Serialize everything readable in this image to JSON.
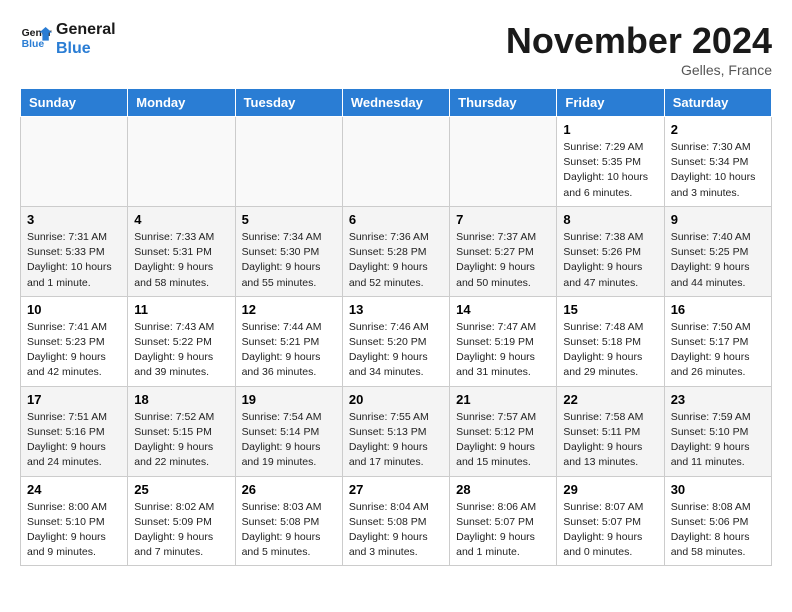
{
  "header": {
    "logo_line1": "General",
    "logo_line2": "Blue",
    "month": "November 2024",
    "location": "Gelles, France"
  },
  "weekdays": [
    "Sunday",
    "Monday",
    "Tuesday",
    "Wednesday",
    "Thursday",
    "Friday",
    "Saturday"
  ],
  "weeks": [
    [
      {
        "day": "",
        "info": ""
      },
      {
        "day": "",
        "info": ""
      },
      {
        "day": "",
        "info": ""
      },
      {
        "day": "",
        "info": ""
      },
      {
        "day": "",
        "info": ""
      },
      {
        "day": "1",
        "info": "Sunrise: 7:29 AM\nSunset: 5:35 PM\nDaylight: 10 hours and 6 minutes."
      },
      {
        "day": "2",
        "info": "Sunrise: 7:30 AM\nSunset: 5:34 PM\nDaylight: 10 hours and 3 minutes."
      }
    ],
    [
      {
        "day": "3",
        "info": "Sunrise: 7:31 AM\nSunset: 5:33 PM\nDaylight: 10 hours and 1 minute."
      },
      {
        "day": "4",
        "info": "Sunrise: 7:33 AM\nSunset: 5:31 PM\nDaylight: 9 hours and 58 minutes."
      },
      {
        "day": "5",
        "info": "Sunrise: 7:34 AM\nSunset: 5:30 PM\nDaylight: 9 hours and 55 minutes."
      },
      {
        "day": "6",
        "info": "Sunrise: 7:36 AM\nSunset: 5:28 PM\nDaylight: 9 hours and 52 minutes."
      },
      {
        "day": "7",
        "info": "Sunrise: 7:37 AM\nSunset: 5:27 PM\nDaylight: 9 hours and 50 minutes."
      },
      {
        "day": "8",
        "info": "Sunrise: 7:38 AM\nSunset: 5:26 PM\nDaylight: 9 hours and 47 minutes."
      },
      {
        "day": "9",
        "info": "Sunrise: 7:40 AM\nSunset: 5:25 PM\nDaylight: 9 hours and 44 minutes."
      }
    ],
    [
      {
        "day": "10",
        "info": "Sunrise: 7:41 AM\nSunset: 5:23 PM\nDaylight: 9 hours and 42 minutes."
      },
      {
        "day": "11",
        "info": "Sunrise: 7:43 AM\nSunset: 5:22 PM\nDaylight: 9 hours and 39 minutes."
      },
      {
        "day": "12",
        "info": "Sunrise: 7:44 AM\nSunset: 5:21 PM\nDaylight: 9 hours and 36 minutes."
      },
      {
        "day": "13",
        "info": "Sunrise: 7:46 AM\nSunset: 5:20 PM\nDaylight: 9 hours and 34 minutes."
      },
      {
        "day": "14",
        "info": "Sunrise: 7:47 AM\nSunset: 5:19 PM\nDaylight: 9 hours and 31 minutes."
      },
      {
        "day": "15",
        "info": "Sunrise: 7:48 AM\nSunset: 5:18 PM\nDaylight: 9 hours and 29 minutes."
      },
      {
        "day": "16",
        "info": "Sunrise: 7:50 AM\nSunset: 5:17 PM\nDaylight: 9 hours and 26 minutes."
      }
    ],
    [
      {
        "day": "17",
        "info": "Sunrise: 7:51 AM\nSunset: 5:16 PM\nDaylight: 9 hours and 24 minutes."
      },
      {
        "day": "18",
        "info": "Sunrise: 7:52 AM\nSunset: 5:15 PM\nDaylight: 9 hours and 22 minutes."
      },
      {
        "day": "19",
        "info": "Sunrise: 7:54 AM\nSunset: 5:14 PM\nDaylight: 9 hours and 19 minutes."
      },
      {
        "day": "20",
        "info": "Sunrise: 7:55 AM\nSunset: 5:13 PM\nDaylight: 9 hours and 17 minutes."
      },
      {
        "day": "21",
        "info": "Sunrise: 7:57 AM\nSunset: 5:12 PM\nDaylight: 9 hours and 15 minutes."
      },
      {
        "day": "22",
        "info": "Sunrise: 7:58 AM\nSunset: 5:11 PM\nDaylight: 9 hours and 13 minutes."
      },
      {
        "day": "23",
        "info": "Sunrise: 7:59 AM\nSunset: 5:10 PM\nDaylight: 9 hours and 11 minutes."
      }
    ],
    [
      {
        "day": "24",
        "info": "Sunrise: 8:00 AM\nSunset: 5:10 PM\nDaylight: 9 hours and 9 minutes."
      },
      {
        "day": "25",
        "info": "Sunrise: 8:02 AM\nSunset: 5:09 PM\nDaylight: 9 hours and 7 minutes."
      },
      {
        "day": "26",
        "info": "Sunrise: 8:03 AM\nSunset: 5:08 PM\nDaylight: 9 hours and 5 minutes."
      },
      {
        "day": "27",
        "info": "Sunrise: 8:04 AM\nSunset: 5:08 PM\nDaylight: 9 hours and 3 minutes."
      },
      {
        "day": "28",
        "info": "Sunrise: 8:06 AM\nSunset: 5:07 PM\nDaylight: 9 hours and 1 minute."
      },
      {
        "day": "29",
        "info": "Sunrise: 8:07 AM\nSunset: 5:07 PM\nDaylight: 9 hours and 0 minutes."
      },
      {
        "day": "30",
        "info": "Sunrise: 8:08 AM\nSunset: 5:06 PM\nDaylight: 8 hours and 58 minutes."
      }
    ]
  ]
}
